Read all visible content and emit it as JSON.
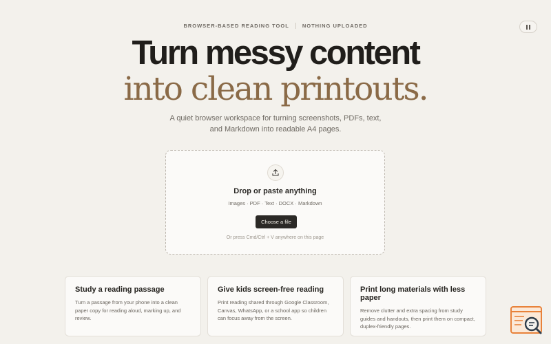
{
  "topbar": {
    "tag1": "BROWSER-BASED READING TOOL",
    "tag2": "NOTHING UPLOADED"
  },
  "headline": {
    "line1": "Turn messy content",
    "line2": "into clean printouts."
  },
  "subtitle": {
    "line1": "A quiet browser workspace for turning screenshots, PDFs, text,",
    "line2": "and Markdown into readable A4 pages."
  },
  "dropzone": {
    "title": "Drop or paste anything",
    "formats": "Images · PDF · Text · DOCX · Markdown",
    "button_label": "Choose a file",
    "hint": "Or press Cmd/Ctrl + V anywhere on this page"
  },
  "cards": [
    {
      "title": "Study a reading passage",
      "body": "Turn a passage from your phone into a clean paper copy for reading aloud, marking up, and review."
    },
    {
      "title": "Give kids screen-free reading",
      "body": "Print reading shared through Google Classroom, Canvas, WhatsApp, or a school app so children can focus away from the screen."
    },
    {
      "title": "Print long materials with less paper",
      "body": "Remove clutter and extra spacing from study guides and handouts, then print them on compact, duplex-friendly pages."
    }
  ],
  "icons": {
    "pause": "pause-icon",
    "upload": "upload-icon",
    "badge": "document-search-icon"
  },
  "colors": {
    "background": "#f3f1ec",
    "accent": "#8a6a47",
    "dark": "#2b2926",
    "badge": "#e8823a"
  }
}
